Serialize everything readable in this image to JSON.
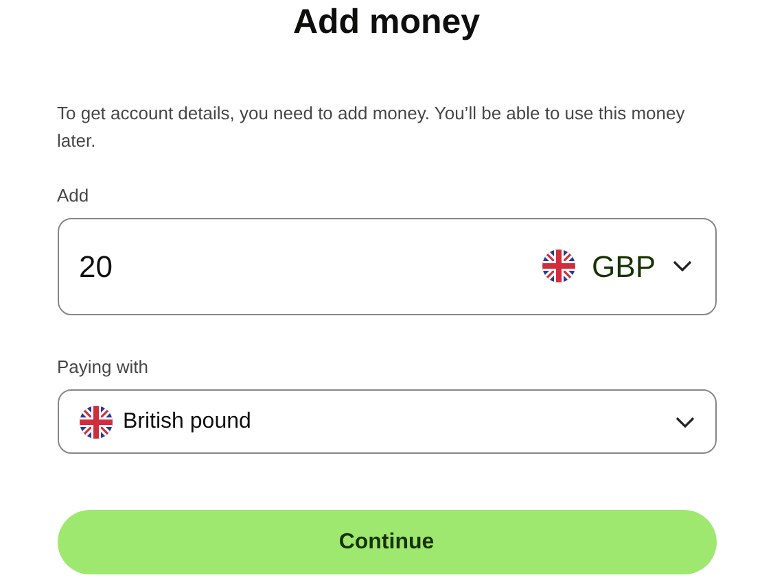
{
  "title": "Add money",
  "description": "To get account details, you need to add money. You’ll be able to use this money later.",
  "amount": {
    "label": "Add",
    "value": "20",
    "currency": "GBP"
  },
  "paying_with": {
    "label": "Paying with",
    "value": "British pound"
  },
  "button": "Continue"
}
